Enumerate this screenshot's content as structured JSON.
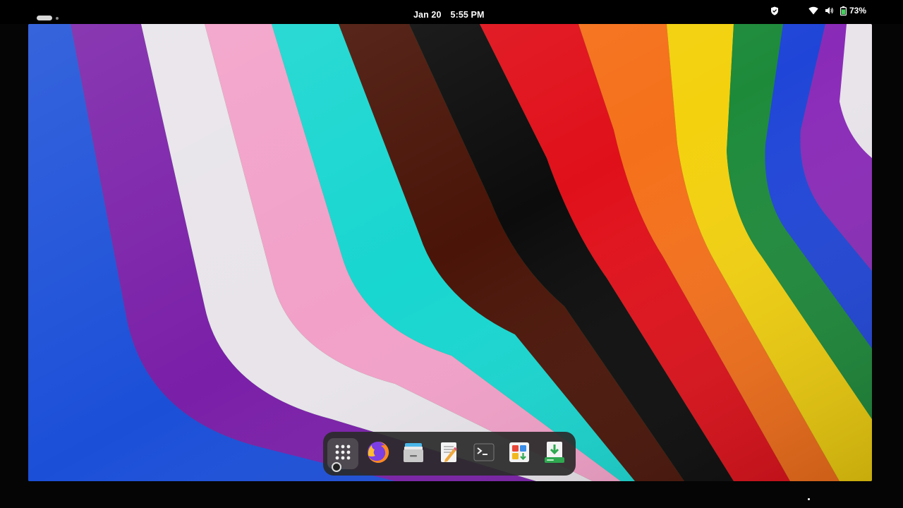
{
  "topbar": {
    "activities_icon": "workspace-indicator",
    "date": "Jan 20",
    "time": "5:55 PM",
    "tray_icons": [
      "shield-icon",
      "wifi-icon",
      "volume-icon",
      "battery-icon"
    ],
    "battery_percent": "73%"
  },
  "wallpaper": {
    "description_colors": [
      "#1b4fd8",
      "#7a1fa8",
      "#e8e4ea",
      "#f2a0c8",
      "#18d6d0",
      "#4a1408",
      "#0c0c0c",
      "#e0101a",
      "#f5701a",
      "#f3d10e",
      "#1d8a3a",
      "#1f45d8",
      "#8a2ab8"
    ]
  },
  "dock": {
    "items": [
      {
        "name": "app-grid",
        "icon": "app-grid-icon",
        "active": true
      },
      {
        "name": "firefox",
        "icon": "firefox-icon"
      },
      {
        "name": "files",
        "icon": "files-icon"
      },
      {
        "name": "text-editor",
        "icon": "text-editor-icon"
      },
      {
        "name": "terminal",
        "icon": "terminal-icon"
      },
      {
        "name": "software",
        "icon": "software-icon"
      },
      {
        "name": "installer",
        "icon": "installer-icon"
      }
    ]
  }
}
